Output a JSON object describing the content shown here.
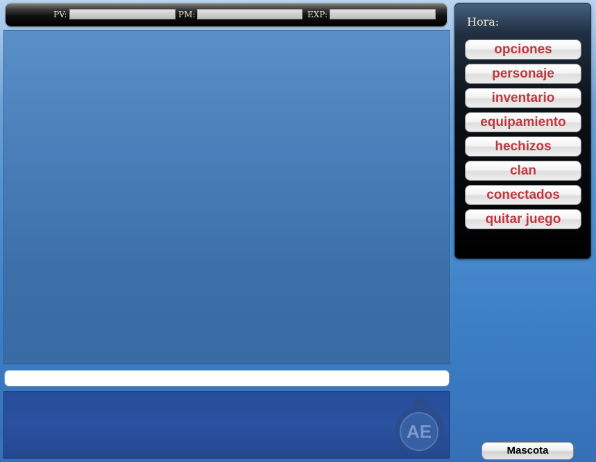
{
  "stats": {
    "pv_label": "PV:",
    "pm_label": "PM:",
    "exp_label": "EXP:"
  },
  "chat": {
    "input_value": "",
    "input_placeholder": ""
  },
  "menu": {
    "hora_label": "Hora:",
    "items": [
      "opciones",
      "personaje",
      "inventario",
      "equipamiento",
      "hechizos",
      "clan",
      "conectados",
      "quitar juego"
    ]
  },
  "mascota_label": "Mascota",
  "logo": {
    "text": "AE",
    "icon": "ae-logo-icon"
  },
  "colors": {
    "menu_text": "#c0393f",
    "view_blue": "#4a7fba",
    "log_blue": "#2a51a0"
  }
}
